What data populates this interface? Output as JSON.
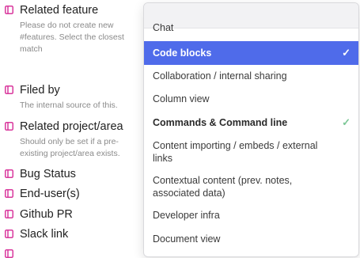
{
  "properties": [
    {
      "name": "Related feature",
      "description": "Please do not create new #features. Select the closest match"
    },
    {
      "name": "Filed by",
      "description": "The internal source of this."
    },
    {
      "name": "Related project/area",
      "description": "Should only be set if a pre-existing project/area exists."
    },
    {
      "name": "Bug Status",
      "description": ""
    },
    {
      "name": "End-user(s)",
      "description": ""
    },
    {
      "name": "Github PR",
      "description": ""
    },
    {
      "name": "Slack link",
      "description": ""
    }
  ],
  "dropdown": {
    "search_placeholder": "",
    "options": [
      {
        "label": "Chat",
        "checked": false,
        "selected": false
      },
      {
        "label": "Code blocks",
        "checked": true,
        "selected": true
      },
      {
        "label": "Collaboration / internal sharing",
        "checked": false,
        "selected": false
      },
      {
        "label": "Column view",
        "checked": false,
        "selected": false
      },
      {
        "label": "Commands & Command line",
        "checked": true,
        "selected": false
      },
      {
        "label": "Content importing / embeds / external links",
        "checked": false,
        "selected": false
      },
      {
        "label": "Contextual content (prev. notes, associated data)",
        "checked": false,
        "selected": false
      },
      {
        "label": "Developer infra",
        "checked": false,
        "selected": false
      },
      {
        "label": "Document view",
        "checked": false,
        "selected": false
      }
    ]
  },
  "colors": {
    "accent": "#4f6bea",
    "property_icon": "#d9389d",
    "check": "#7cc796"
  }
}
